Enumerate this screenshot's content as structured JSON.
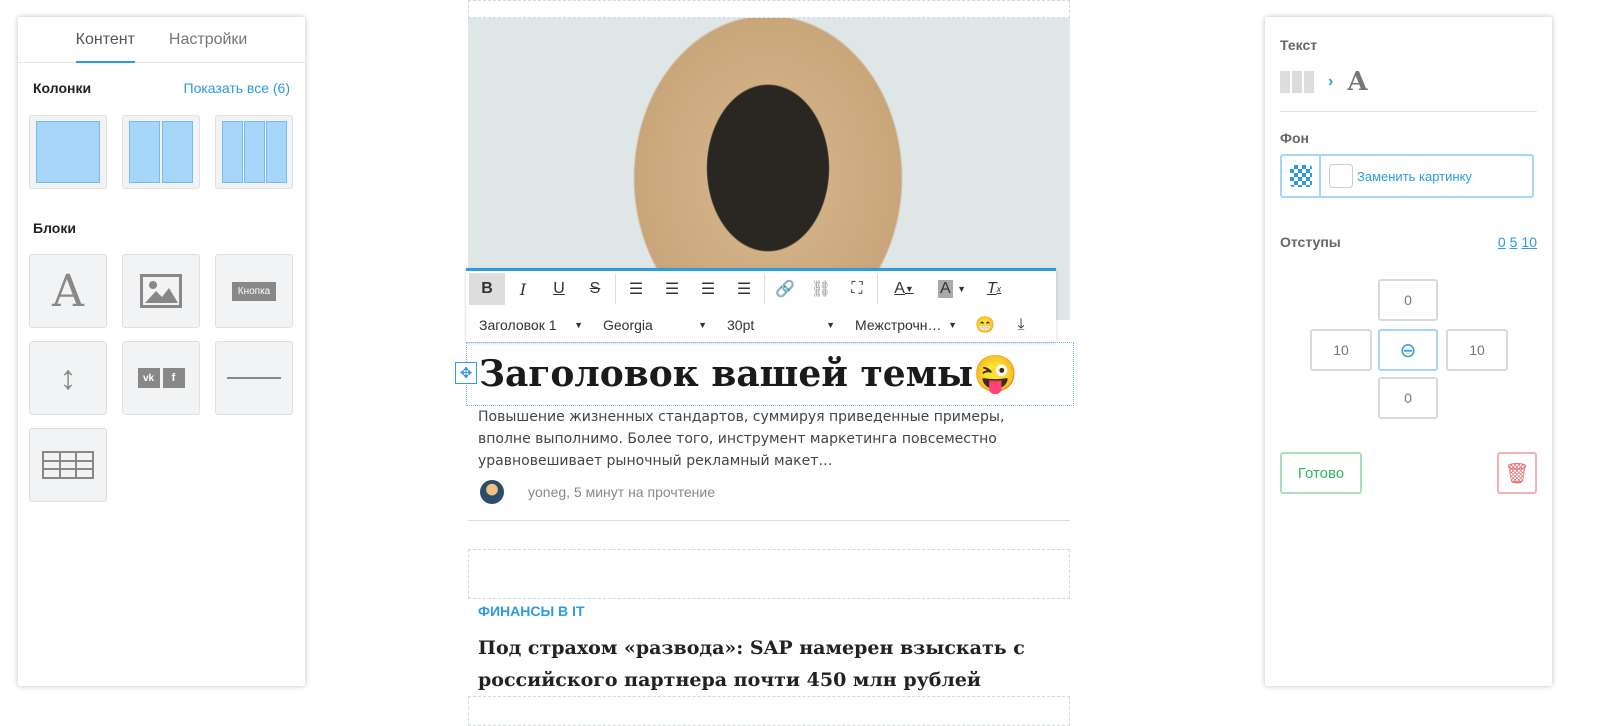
{
  "left_panel": {
    "tabs": [
      {
        "label": "Контент"
      },
      {
        "label": "Настройки"
      }
    ],
    "columns_title": "Колонки",
    "show_all": "Показать все (6)",
    "blocks_title": "Блоки",
    "button_block_label": "Кнопка",
    "social_labels": [
      "vk",
      "f"
    ]
  },
  "editor": {
    "toolbar": {
      "heading_style": "Заголовок 1",
      "font": "Georgia",
      "size": "30pt",
      "line_height": "Межстрочн…"
    }
  },
  "article": {
    "heading": "Заголовок вашей темы",
    "emoji": "😜",
    "excerpt": "Повышение жизненных стандартов, суммируя приведенные примеры, вполне выполнимо. Более того, инструмент маркетинга повсеместно уравновешивает рыночный рекламный макет…",
    "meta": "yoneg, 5 минут на прочтение"
  },
  "next_article": {
    "category": "ФИНАНСЫ В IT",
    "title": "Под страхом «развода»: SAP намерен взыскать с российского партнера почти 450 млн рублей"
  },
  "right_panel": {
    "title": "Текст",
    "background_title": "Фон",
    "replace_image": "Заменить картинку",
    "padding_title": "Отступы",
    "presets": [
      "0",
      "5",
      "10"
    ],
    "padding": {
      "top": "0",
      "left": "10",
      "right": "10",
      "bottom": "0"
    },
    "done": "Готово"
  },
  "colors": {
    "accent": "#2d9be0",
    "done": "#2eb85c",
    "delete": "#e57373"
  }
}
